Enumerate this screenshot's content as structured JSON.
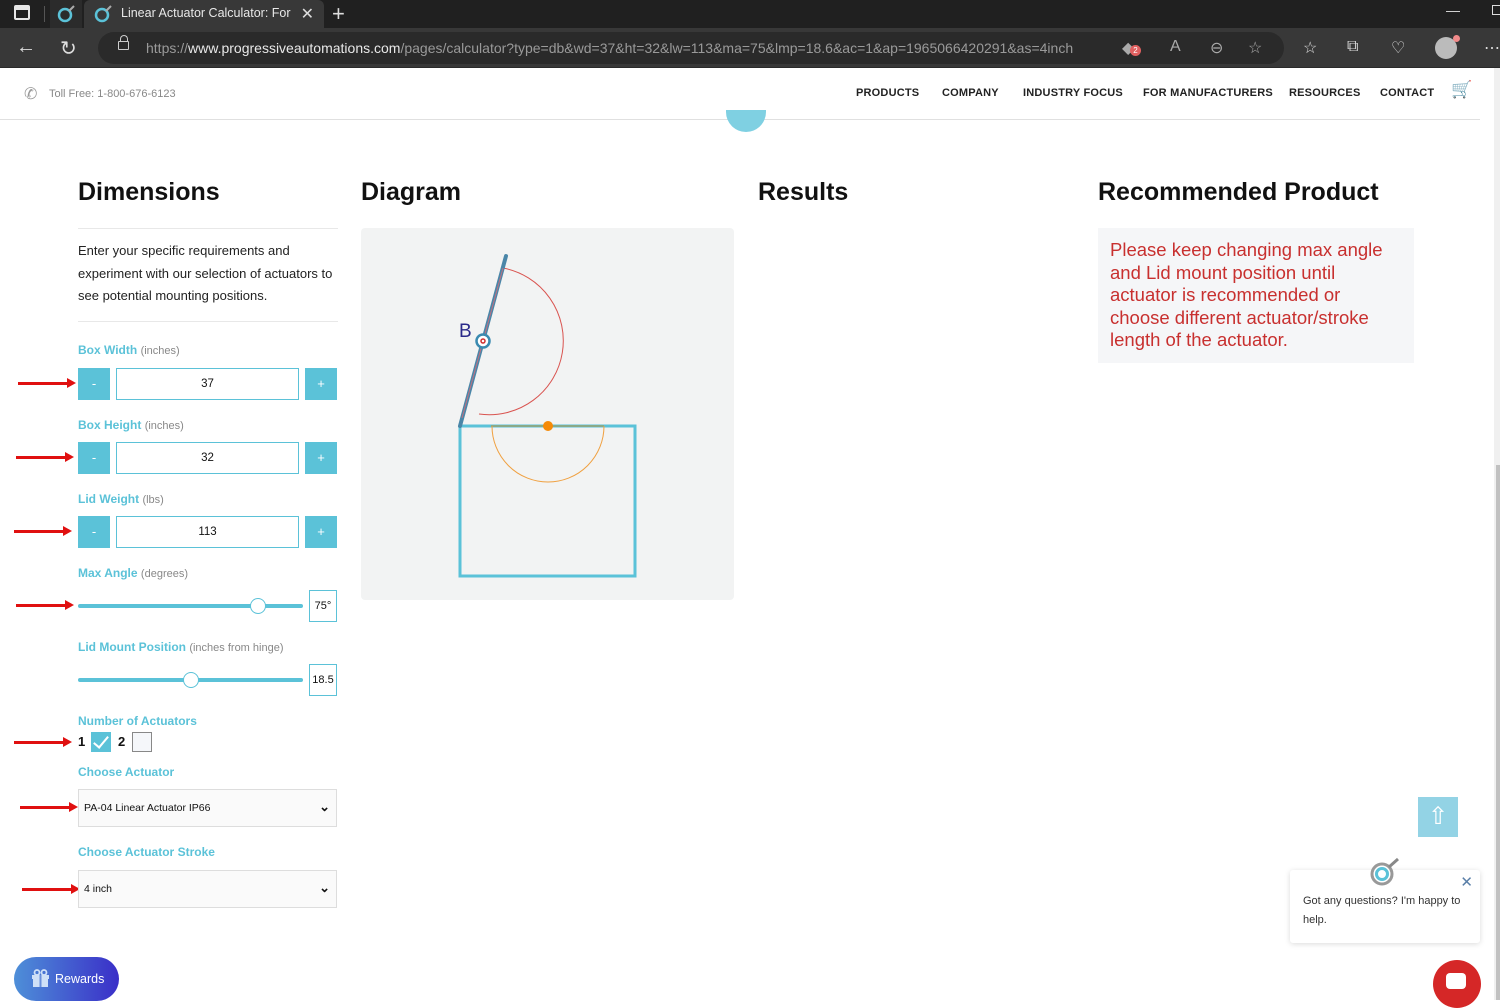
{
  "browser": {
    "tab_title": "Linear Actuator Calculator: Force Calculator",
    "url_scheme": "https://",
    "url_host": "www.progressiveautomations.com",
    "url_path": "/pages/calculator?type=db&wd=37&ht=32&lw=113&ma=75&lmp=18.6&ac=1&ap=1965066420291&as=4inch",
    "extension_badge": "2"
  },
  "header": {
    "toll_free": "Toll Free: 1-800-676-6123",
    "nav": [
      "PRODUCTS",
      "COMPANY",
      "INDUSTRY FOCUS",
      "FOR MANUFACTURERS",
      "RESOURCES",
      "CONTACT"
    ]
  },
  "sections": {
    "dimensions": "Dimensions",
    "diagram": "Diagram",
    "results": "Results",
    "recommended": "Recommended Product"
  },
  "dimensions": {
    "intro": "Enter your specific requirements and experiment with our selection of actuators to see potential mounting positions.",
    "box_width": {
      "label": "Box Width",
      "unit": "(inches)",
      "value": "37",
      "minus": "-",
      "plus": "+"
    },
    "box_height": {
      "label": "Box Height",
      "unit": "(inches)",
      "value": "32",
      "minus": "-",
      "plus": "+"
    },
    "lid_weight": {
      "label": "Lid Weight",
      "unit": "(lbs)",
      "value": "113",
      "minus": "-",
      "plus": "+"
    },
    "max_angle": {
      "label": "Max Angle",
      "unit": "(degrees)",
      "value": "75°",
      "fraction": 0.8
    },
    "lid_mount": {
      "label": "Lid Mount Position",
      "unit": "(inches from hinge)",
      "value": "18.5",
      "fraction": 0.5
    },
    "num_actuators": {
      "label": "Number of Actuators",
      "options": [
        {
          "label": "1",
          "checked": true
        },
        {
          "label": "2",
          "checked": false
        }
      ]
    },
    "actuator": {
      "label": "Choose Actuator",
      "selected": "PA-04 Linear Actuator IP66"
    },
    "stroke": {
      "label": "Choose Actuator Stroke",
      "selected": "4 inch"
    }
  },
  "diagram": {
    "point_label": "B",
    "colors": {
      "box": "#5bc2d8",
      "lid": "#4a86a8",
      "lid_arc": "#d9534f",
      "mount_arc": "#f0a040",
      "mount_dot": "#f58a07",
      "label": "#2a2a8a"
    }
  },
  "recommended": {
    "message": "Please keep changing max angle and Lid mount position until actuator is recommended or choose different actuator/stroke length of the actuator."
  },
  "widgets": {
    "to_top": "⇧",
    "chat_message": "Got any questions? I'm happy to help.",
    "chat_close": "✕",
    "rewards": "Rewards"
  },
  "colors": {
    "accent": "#5bc2d8",
    "warning_text": "#c8302f",
    "annotation_arrow": "#e01010"
  }
}
